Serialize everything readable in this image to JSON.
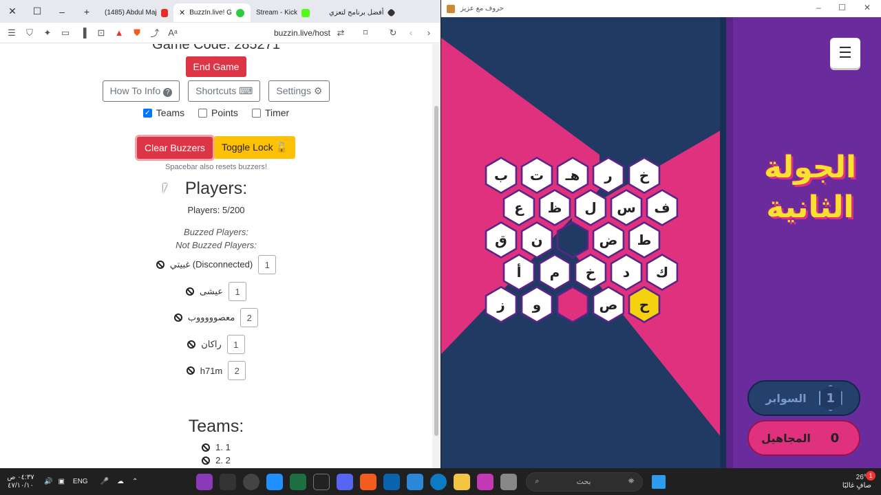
{
  "browser": {
    "tabs": [
      {
        "label": "(1485) Abdul Maj",
        "active": false
      },
      {
        "label": "BuzzIn.live! G",
        "active": true
      },
      {
        "label": "Stream - Kick",
        "active": false
      },
      {
        "label": "أفضل برنامج لتعزي",
        "active": false
      }
    ],
    "url": "buzzin.live/host"
  },
  "host": {
    "game_code_label": "Game Code: 285271",
    "end_game": "End Game",
    "how_to_info": "How To Info",
    "shortcuts": "Shortcuts",
    "settings": "Settings",
    "opt_teams": "Teams",
    "opt_points": "Points",
    "opt_timer": "Timer",
    "clear_buzzers": "Clear Buzzers",
    "toggle_lock": "Toggle Lock",
    "spacebar_note": "Spacebar also resets buzzers!",
    "players_heading": "Players:",
    "players_count": "Players: 5/200",
    "buzzed_players": "Buzzed Players:",
    "not_buzzed_players": "Not Buzzed Players:",
    "players": [
      {
        "name": "غبيتي (Disconnected)",
        "team": "1"
      },
      {
        "name": "عيشى",
        "team": "1"
      },
      {
        "name": "معصوووووب",
        "team": "2"
      },
      {
        "name": "راكان",
        "team": "1"
      },
      {
        "name": "h71m",
        "team": "2"
      }
    ],
    "teams_heading": "Teams:",
    "teams": [
      {
        "label": "1.  1"
      },
      {
        "label": "2.  2"
      }
    ]
  },
  "game": {
    "window_title": "حروف مع عزيز",
    "round_title": "الجولة الثانية",
    "team_blue": {
      "name": "السوابر",
      "score": "1"
    },
    "team_pink": {
      "name": "المجاهيل",
      "score": "0"
    },
    "cells": [
      "ب",
      "ت",
      "هـ",
      "ر",
      "خ",
      "ع",
      "ظ",
      "ل",
      "س",
      "ف",
      "ق",
      "ن",
      "",
      "ض",
      "ط",
      "أ",
      "م",
      "خ",
      "د",
      "ك",
      "ز",
      "و",
      "",
      "ص",
      "ح"
    ],
    "cell_states": [
      "white",
      "white",
      "white",
      "white",
      "white",
      "white",
      "white",
      "white",
      "white",
      "white",
      "white",
      "white",
      "dark",
      "white",
      "white",
      "white",
      "white",
      "white",
      "white",
      "white",
      "white",
      "white",
      "pink",
      "white",
      "yellow"
    ]
  },
  "taskbar": {
    "search_placeholder": "بحث",
    "lang": "ENG",
    "time": "٠٤:٣٧ ص",
    "date": "٤٧/١٠/١٠",
    "weather_temp": "26°C",
    "weather_desc": "صافٍ غالبًا",
    "notif_count": "1"
  }
}
